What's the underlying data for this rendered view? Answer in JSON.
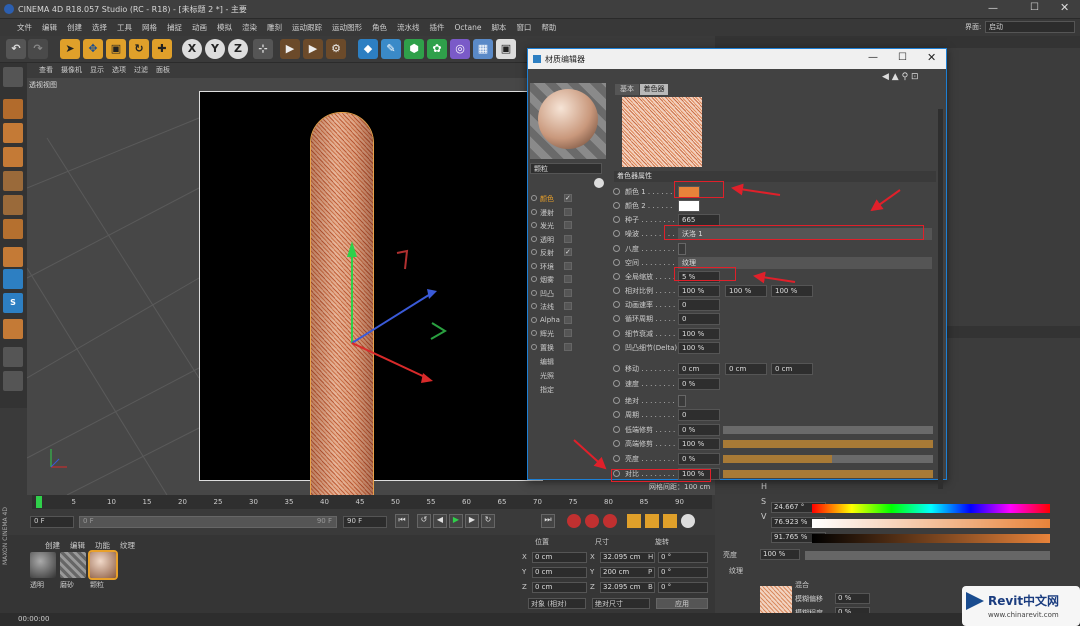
{
  "app": {
    "title": "CINEMA 4D R18.057 Studio (RC - R18) - [未标题 2 *] - 主要",
    "layout_label": "界面:",
    "layout_value": "启动"
  },
  "menu": [
    "文件",
    "编辑",
    "创建",
    "选择",
    "工具",
    "网格",
    "捕捉",
    "动画",
    "模拟",
    "渲染",
    "雕刻",
    "运动跟踪",
    "运动图形",
    "角色",
    "流水线",
    "插件",
    "Octane",
    "脚本",
    "窗口",
    "帮助"
  ],
  "toolbar": {
    "x": "X",
    "y": "Y",
    "z": "Z"
  },
  "viewport": {
    "menu": [
      "查看",
      "摄像机",
      "显示",
      "选项",
      "过滤",
      "面板"
    ],
    "name": "透视视图",
    "grid": "网格间距：100 cm"
  },
  "timeline": {
    "ticks": [
      "0",
      "5",
      "10",
      "15",
      "20",
      "25",
      "30",
      "35",
      "40",
      "45",
      "50",
      "55",
      "60",
      "65",
      "70",
      "75",
      "80",
      "85",
      "90"
    ],
    "frame_start": "0 F",
    "frame_cur": "0 F",
    "frame_end": "90 F",
    "frame_end2": "90 F"
  },
  "materials": {
    "menu": [
      "创建",
      "编辑",
      "功能",
      "纹理"
    ],
    "items": [
      "透明",
      "磨砂",
      "颗粒"
    ]
  },
  "coords": {
    "headers": [
      "位置",
      "尺寸",
      "旋转"
    ],
    "rows": [
      [
        "X",
        "0 cm",
        "X",
        "32.095 cm",
        "H",
        "0 °"
      ],
      [
        "Y",
        "0 cm",
        "Y",
        "200 cm",
        "P",
        "0 °"
      ],
      [
        "Z",
        "0 cm",
        "Z",
        "32.095 cm",
        "B",
        "0 °"
      ]
    ],
    "mode": "对象 (相对)",
    "size_mode": "绝对尺寸",
    "apply": "应用"
  },
  "status": {
    "time": "00:00:00"
  },
  "editor": {
    "title": "材质编辑器",
    "mat_name": "颗粒",
    "tabs": [
      "基本",
      "着色器"
    ],
    "section": "着色器属性",
    "channels": [
      {
        "name": "颜色",
        "on": true
      },
      {
        "name": "漫射",
        "on": false
      },
      {
        "name": "发光",
        "on": false
      },
      {
        "name": "透明",
        "on": false
      },
      {
        "name": "反射",
        "on": true
      },
      {
        "name": "环境",
        "on": false
      },
      {
        "name": "烟雾",
        "on": false
      },
      {
        "name": "凹凸",
        "on": false
      },
      {
        "name": "法线",
        "on": false
      },
      {
        "name": "Alpha",
        "on": false
      },
      {
        "name": "辉光",
        "on": false
      },
      {
        "name": "置换",
        "on": false
      }
    ],
    "extra": [
      "编辑",
      "光照",
      "指定"
    ],
    "props": [
      {
        "label": "颜色 1 . . . . . .",
        "value": "",
        "swatch": "#e8833a"
      },
      {
        "label": "颜色 2 . . . . . .",
        "value": "",
        "swatch": "#ffffff"
      },
      {
        "label": "种子 . . . . . . . .",
        "value": "665"
      },
      {
        "label": "噪波 . . . . . . . .",
        "value": "沃洛 1"
      },
      {
        "label": "八度 . . . . . . . .",
        "value": ""
      },
      {
        "label": "空间 . . . . . . . .",
        "value": "纹理"
      },
      {
        "label": "全局缩放 . . . . .",
        "value": "5 %"
      },
      {
        "label": "相对比例 . . . . .",
        "value": "100 %",
        "v2": "100 %",
        "v3": "100 %"
      },
      {
        "label": "动画速率 . . . . .",
        "value": "0"
      },
      {
        "label": "循环周期 . . . . .",
        "value": "0"
      },
      {
        "label": "细节衰减 . . . . .",
        "value": "100 %"
      },
      {
        "label": "凹凸细节(Delta)",
        "value": "100 %"
      },
      {
        "label": "移动 . . . . . . . .",
        "value": "0 cm",
        "v2": "0 cm",
        "v3": "0 cm"
      },
      {
        "label": "速度 . . . . . . . .",
        "value": "0 %"
      },
      {
        "label": "绝对 . . . . . . . .",
        "value": ""
      },
      {
        "label": "周期 . . . . . . . .",
        "value": "0"
      },
      {
        "label": "低端修剪 . . . . .",
        "value": "0 %"
      },
      {
        "label": "高端修剪 . . . . .",
        "value": "100 %"
      },
      {
        "label": "亮度 . . . . . . . .",
        "value": "0 %"
      },
      {
        "label": "对比 . . . . . . . .",
        "value": "100 %"
      }
    ]
  },
  "attr": {
    "h": "24.667 °",
    "s": "76.923 %",
    "v": "91.765 %",
    "brightness_label": "亮度",
    "brightness": "100 %",
    "texture_label": "纹理",
    "mix_label": "混合",
    "blur_offset": "模糊偏移",
    "blur_offset_v": "0 %",
    "blur_degree": "模糊程度",
    "blur_degree_v": "0 %"
  },
  "watermark": {
    "brand": "Revit中文网",
    "url": "www.chinarevit.com"
  },
  "colors": {
    "accent": "#e8833a",
    "highlight": "#e0202a"
  }
}
